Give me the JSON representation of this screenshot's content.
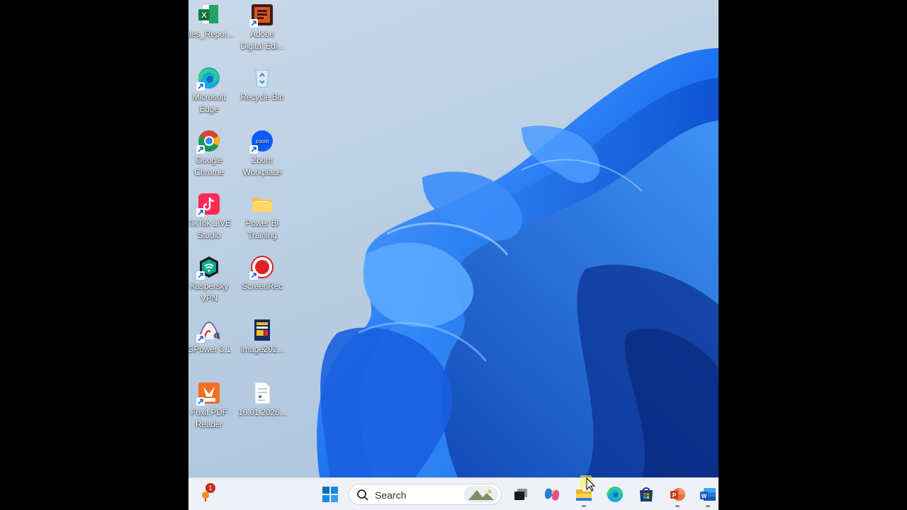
{
  "desktop": {
    "icons": [
      {
        "label": "ales_Repor...",
        "icon": "excel-icon"
      },
      {
        "label": "Adobe\nDigital Edi...",
        "icon": "adobe-digital-editions-icon"
      },
      {
        "label": "Microsoft\nEdge",
        "icon": "edge-icon"
      },
      {
        "label": "Recycle Bin",
        "icon": "recycle-bin-icon"
      },
      {
        "label": "Google\nChrome",
        "icon": "chrome-icon"
      },
      {
        "label": "Zoom\nWorkplace",
        "icon": "zoom-icon"
      },
      {
        "label": "TikTok LIVE\nStudio",
        "icon": "tiktok-icon"
      },
      {
        "label": "Power BI\nTraining",
        "icon": "folder-icon"
      },
      {
        "label": "Kaspersky\nVPN",
        "icon": "kaspersky-vpn-icon"
      },
      {
        "label": "ScreenRec",
        "icon": "screenrec-icon"
      },
      {
        "label": "GPower 3.1",
        "icon": "gpower-icon"
      },
      {
        "label": "Image202...",
        "icon": "image-file-icon"
      },
      {
        "label": "Foxit PDF\nReader",
        "icon": "foxit-icon"
      },
      {
        "label": "16.01.2026...",
        "icon": "document-file-icon"
      }
    ],
    "zoom_icon_text": "zoom"
  },
  "taskbar": {
    "weather_badge": "1",
    "search_placeholder": "Search",
    "apps": [
      "start-icon",
      "task-view-icon",
      "copilot-icon",
      "file-explorer-icon",
      "edge-icon",
      "microsoft-store-icon",
      "powerpoint-icon",
      "word-icon"
    ]
  },
  "colors": {
    "taskbar_bg": "#eef1f6",
    "wallpaper_blue": "#1e6ff0",
    "badge_red": "#c42b1c"
  }
}
